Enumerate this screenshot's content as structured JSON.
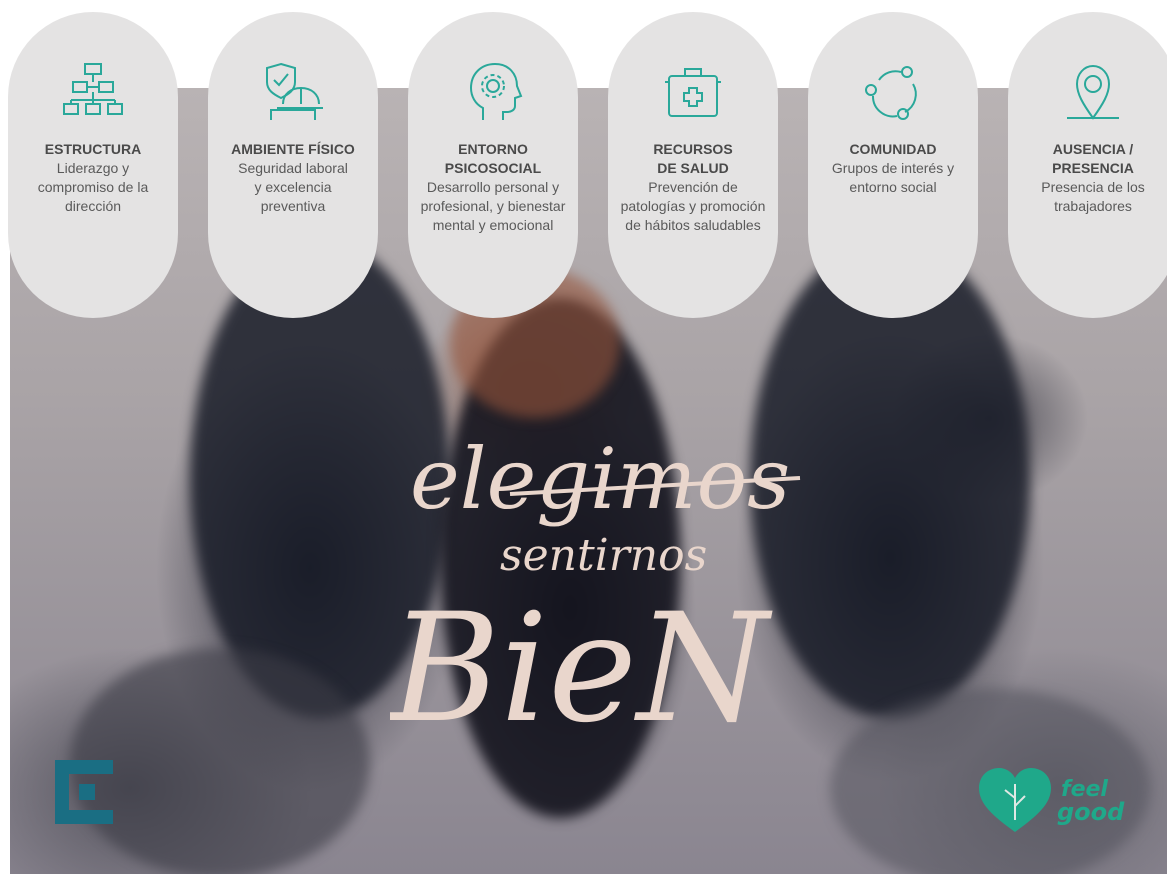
{
  "pillars": [
    {
      "icon": "org-chart-icon",
      "title": "ESTRUCTURA",
      "desc": "Liderazgo y compromiso de la dirección"
    },
    {
      "icon": "safety-helmet-shield-icon",
      "title": "AMBIENTE FÍSICO",
      "desc": "Seguridad laboral y excelencia preventiva"
    },
    {
      "icon": "head-gear-icon",
      "title": "ENTORNO PSICOSOCIAL",
      "desc": "Desarrollo personal y profesional, y bienestar mental y emocional"
    },
    {
      "icon": "first-aid-kit-icon",
      "title": "RECURSOS DE SALUD",
      "desc": "Prevención de patologías y promoción de hábitos saludables"
    },
    {
      "icon": "community-circle-icon",
      "title": "COMUNIDAD",
      "desc": "Grupos de interés y entorno social"
    },
    {
      "icon": "location-pin-icon",
      "title": "AUSENCIA / PRESENCIA",
      "desc": "Presencia de los trabajadores"
    }
  ],
  "slogan": {
    "line1": "elegimos",
    "line2": "sentirnos",
    "line3": "BieN"
  },
  "brand": {
    "right_logo_line1": "feel",
    "right_logo_line2": "good"
  },
  "colors": {
    "accent_teal": "#2aa89a",
    "bubble_bg": "#e4e3e3",
    "logo_left": "#1a6e83",
    "logo_right": "#1fa88a",
    "slogan": "#e9d6cc"
  }
}
